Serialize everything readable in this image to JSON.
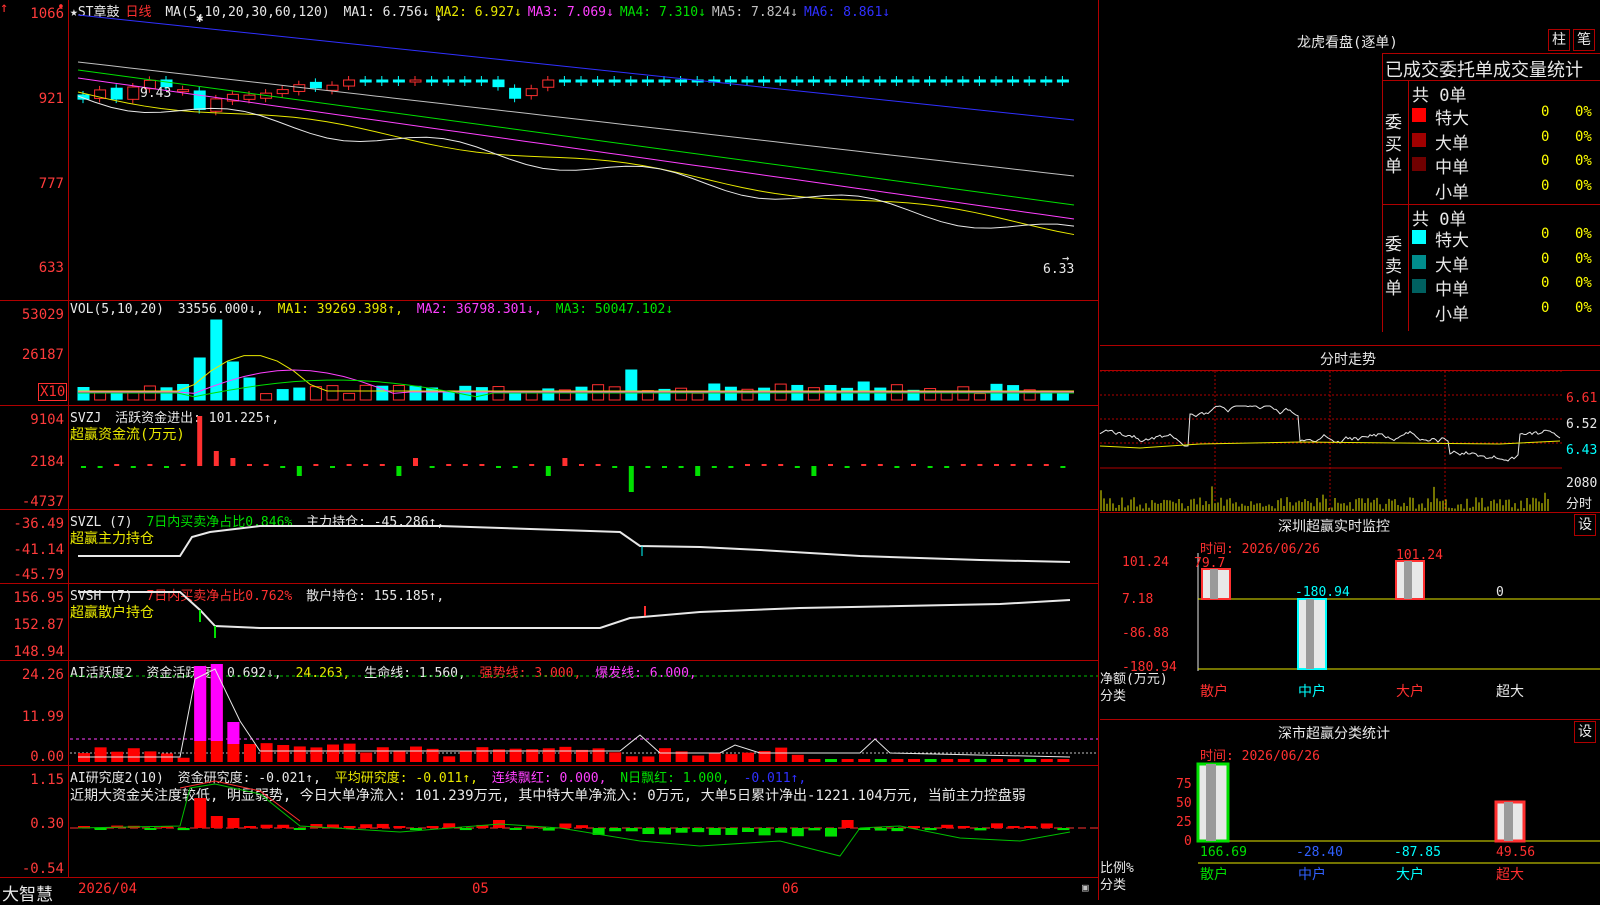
{
  "main_chart": {
    "stock_name": "★ST章鼓",
    "period": "日线",
    "ma_label": "MA(5,10,20,30,60,120)",
    "ma_values": [
      {
        "name": "MA1",
        "value": "6.756",
        "arrow": "↓",
        "color": "#e8e8e8"
      },
      {
        "name": "MA2",
        "value": "6.927",
        "arrow": "↓",
        "color": "#e8e800"
      },
      {
        "name": "MA3",
        "value": "7.069",
        "arrow": "↓",
        "color": "#ff40ff"
      },
      {
        "name": "MA4",
        "value": "7.310",
        "arrow": "↓",
        "color": "#00e000"
      },
      {
        "name": "MA5",
        "value": "7.824",
        "arrow": "↓",
        "color": "#c0c0c0"
      },
      {
        "name": "MA6",
        "value": "8.861",
        "arrow": "↓",
        "color": "#3030ff"
      }
    ],
    "y_ticks": [
      "1066",
      "921",
      "777",
      "633"
    ],
    "high_marker": "9.43",
    "low_marker": "6.33",
    "arrow_marker": "↑"
  },
  "vol_panel": {
    "label": "VOL(5,10,20)",
    "value": "33556.000↓,",
    "ma1": "MA1: 39269.398↑,",
    "ma2": "MA2: 36798.301↓,",
    "ma3": "MA3: 50047.102↓",
    "y_ticks": [
      "53029",
      "26187"
    ],
    "scale_badge": "X10"
  },
  "svzj_panel": {
    "label": "SVZJ",
    "title": "活跃资金进出: 101.225↑,",
    "subtitle": "超赢资金流(万元)",
    "y_ticks": [
      "9104",
      "2184",
      "-4737"
    ]
  },
  "svzl_panel": {
    "label": "SVZL (7)",
    "green_text": "7日内买卖净占比0.846%",
    "value_text": "主力持仓: -45.286↑,",
    "subtitle": "超赢主力持仓",
    "y_ticks": [
      "-36.49",
      "-41.14",
      "-45.79"
    ]
  },
  "svsh_panel": {
    "label": "SVSH (7)",
    "red_text": "7日内买卖净占比0.762%",
    "value_text": "散户持仓: 155.185↑,",
    "subtitle": "超赢散户持仓",
    "y_ticks": [
      "156.95",
      "152.87",
      "148.94"
    ]
  },
  "ai_active_panel": {
    "label": "AI活跃度2",
    "value1": "资金活跃度: 0.692↓,",
    "value2": "24.263,",
    "value3": "生命线: 1.560,",
    "value4": "强势线: 3.000,",
    "value5": "爆发线: 6.000,",
    "y_ticks": [
      "24.26",
      "11.99",
      "0.00"
    ]
  },
  "ai_research_panel": {
    "label": "AI研究度2(10)",
    "value1": "资金研究度: -0.021↑,",
    "value2": "平均研究度: -0.011↑,",
    "value3": "连续飘红: 0.000,",
    "value4": "N日飘红: 1.000,",
    "value5": "-0.011↑,",
    "commentary": "近期大资金关注度较低, 明显弱势, 今日大单净流入: 101.239万元, 其中特大单净流入: 0万元, 大单5日累计净出-1221.104万元, 当前主力控盘弱",
    "y_ticks": [
      "1.15",
      "0.30",
      "-0.54"
    ]
  },
  "bottom_bar": {
    "brand": "大智慧",
    "date_label": "2026/04",
    "months": [
      "05",
      "06"
    ]
  },
  "longhu": {
    "title": "龙虎看盘(逐单)",
    "btn_zhu": "柱",
    "btn_bi": "笔",
    "header": "已成交委托单成交量统计",
    "buy_group": {
      "side_label": [
        "委",
        "买",
        "单"
      ],
      "total": "共 0单",
      "rows": [
        {
          "name": "特大",
          "count": "0",
          "pct": "0%",
          "color": "#ff0000"
        },
        {
          "name": "大单",
          "count": "0",
          "pct": "0%",
          "color": "#a00000"
        },
        {
          "name": "中单",
          "count": "0",
          "pct": "0%",
          "color": "#700000"
        },
        {
          "name": "小单",
          "count": "0",
          "pct": "0%",
          "color": "#000000"
        }
      ]
    },
    "sell_group": {
      "side_label": [
        "委",
        "卖",
        "单"
      ],
      "total": "共 0单",
      "rows": [
        {
          "name": "特大",
          "count": "0",
          "pct": "0%",
          "color": "#00ffff"
        },
        {
          "name": "大单",
          "count": "0",
          "pct": "0%",
          "color": "#008c8c"
        },
        {
          "name": "中单",
          "count": "0",
          "pct": "0%",
          "color": "#006060"
        },
        {
          "name": "小单",
          "count": "0",
          "pct": "0%",
          "color": "#000000"
        }
      ]
    }
  },
  "intraday": {
    "title": "分时走势",
    "price_ticks": [
      "6.61",
      "6.52",
      "6.43"
    ],
    "vol_tick": "2080",
    "vol_label": "分时"
  },
  "sz_monitor": {
    "title": "深圳超赢实时监控",
    "btn": "设",
    "time": "时间: 2026/06/26",
    "y_ticks": [
      "101.24",
      "7.18",
      "-86.88",
      "-180.94"
    ],
    "y_unit": "净额(万元)",
    "x_unit": "分类",
    "bar_labels": [
      "79.7",
      "-180.94",
      "101.24",
      "0"
    ],
    "categories": [
      "散户",
      "中户",
      "大户",
      "超大"
    ]
  },
  "sz_stats": {
    "title": "深市超赢分类统计",
    "btn": "设",
    "time": "时间: 2026/06/26",
    "y_ticks": [
      "75",
      "50",
      "25",
      "0"
    ],
    "y_unit": "比例%",
    "x_unit": "分类",
    "values": [
      "166.69",
      "-28.40",
      "-87.85",
      "49.56"
    ],
    "categories": [
      "散户",
      "中户",
      "大户",
      "超大"
    ]
  }
}
